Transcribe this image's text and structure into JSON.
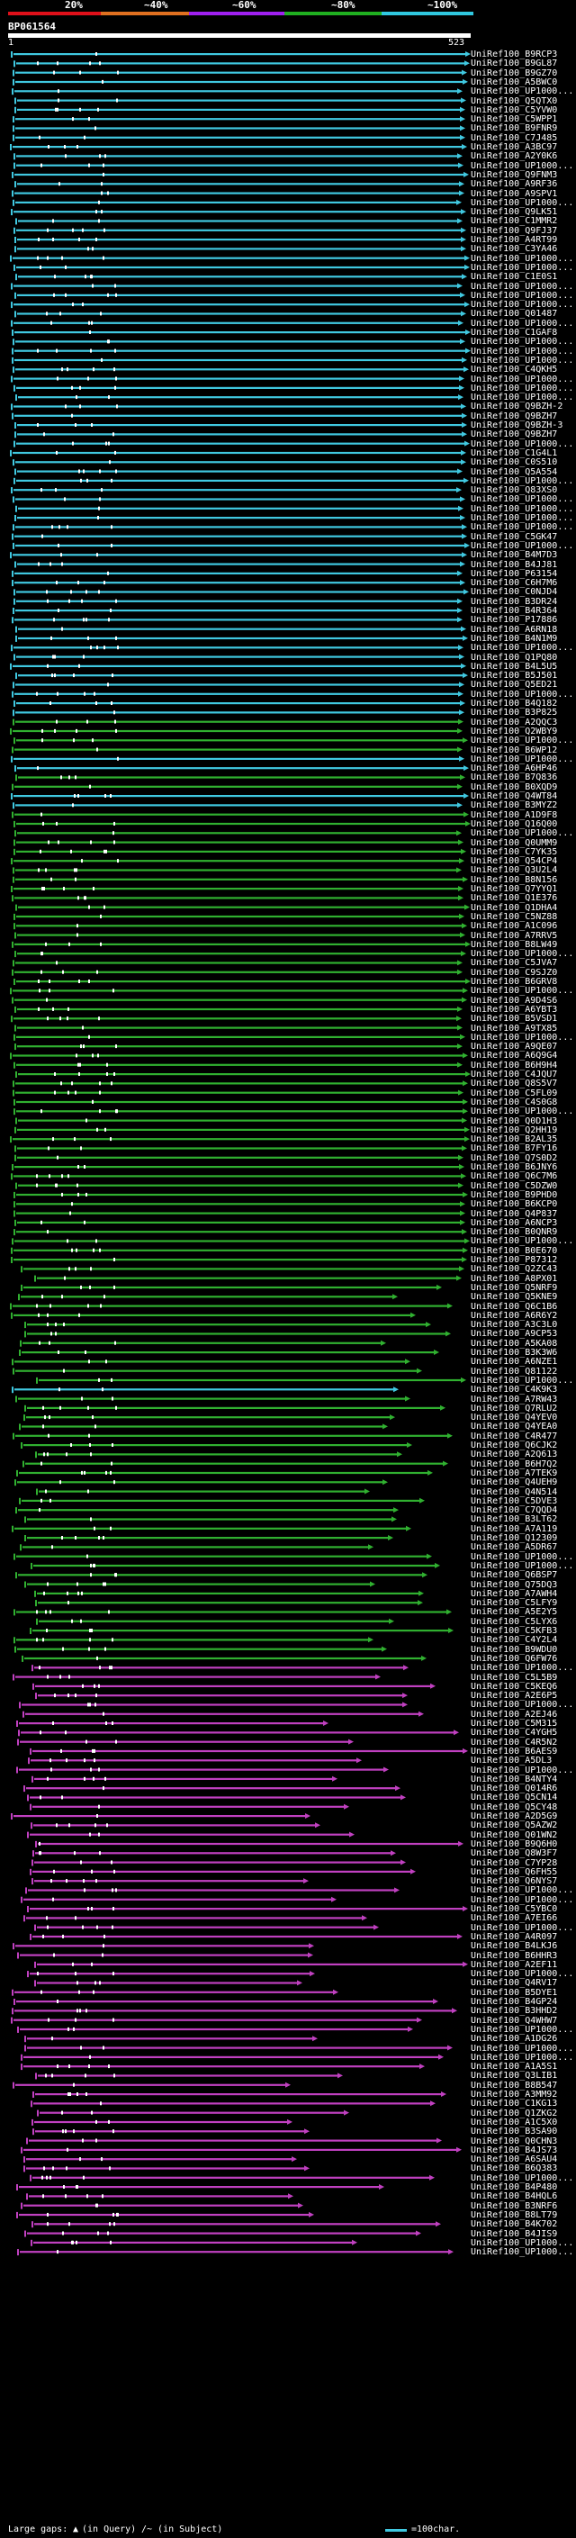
{
  "scale": {
    "ticks": [
      "20%",
      "~40%",
      "~60%",
      "~80%",
      "~100%"
    ],
    "band_colors": [
      "#e0101a",
      "#e07020",
      "#a020f0",
      "#20b020",
      "#30c8e0"
    ]
  },
  "query": {
    "title": "BP061564",
    "start": "1",
    "end": "523"
  },
  "colors": {
    "background": "#000000",
    "cyan": "#40c8e0",
    "green": "#30b030",
    "magenta": "#c040c0",
    "white": "#ffffff"
  },
  "hits": [
    {
      "label": "UniRef100_B9RCP3",
      "c": "cyan"
    },
    {
      "label": "UniRef100_B9GL87",
      "c": "cyan"
    },
    {
      "label": "UniRef100_B9GZ70",
      "c": "cyan"
    },
    {
      "label": "UniRef100_A5BWC0",
      "c": "cyan"
    },
    {
      "label": "UniRef100_UP1000...",
      "c": "cyan"
    },
    {
      "label": "UniRef100_Q5QTX0",
      "c": "cyan"
    },
    {
      "label": "UniRef100_C5YVW0",
      "c": "cyan"
    },
    {
      "label": "UniRef100_C5WPP1",
      "c": "cyan"
    },
    {
      "label": "UniRef100_B9FNR9",
      "c": "cyan"
    },
    {
      "label": "UniRef100_C7J485",
      "c": "cyan"
    },
    {
      "label": "UniRef100_A3BC97",
      "c": "cyan"
    },
    {
      "label": "UniRef100_A2Y0K6",
      "c": "cyan"
    },
    {
      "label": "UniRef100_UP1000...",
      "c": "cyan"
    },
    {
      "label": "UniRef100_Q9FNM3",
      "c": "cyan"
    },
    {
      "label": "UniRef100_A9RF36",
      "c": "cyan"
    },
    {
      "label": "UniRef100_A9SPV1",
      "c": "cyan"
    },
    {
      "label": "UniRef100_UP1000...",
      "c": "cyan"
    },
    {
      "label": "UniRef100_Q9LK51",
      "c": "cyan"
    },
    {
      "label": "UniRef100_C1MMR2",
      "c": "cyan"
    },
    {
      "label": "UniRef100_Q9FJ37",
      "c": "cyan"
    },
    {
      "label": "UniRef100_A4RT99",
      "c": "cyan"
    },
    {
      "label": "UniRef100_C3YA46",
      "c": "cyan"
    },
    {
      "label": "UniRef100_UP1000...",
      "c": "cyan"
    },
    {
      "label": "UniRef100_UP1000...",
      "c": "cyan"
    },
    {
      "label": "UniRef100_C1E0S1",
      "c": "cyan"
    },
    {
      "label": "UniRef100_UP1000...",
      "c": "cyan"
    },
    {
      "label": "UniRef100_UP1000...",
      "c": "cyan"
    },
    {
      "label": "UniRef100_UP1000...",
      "c": "cyan"
    },
    {
      "label": "UniRef100_Q01487",
      "c": "cyan"
    },
    {
      "label": "UniRef100_UP1000...",
      "c": "cyan"
    },
    {
      "label": "UniRef100_C1GAF8",
      "c": "cyan"
    },
    {
      "label": "UniRef100_UP1000...",
      "c": "cyan"
    },
    {
      "label": "UniRef100_UP1000...",
      "c": "cyan"
    },
    {
      "label": "UniRef100_UP1000...",
      "c": "cyan"
    },
    {
      "label": "UniRef100_C4QKH5",
      "c": "cyan"
    },
    {
      "label": "UniRef100_UP1000...",
      "c": "cyan"
    },
    {
      "label": "UniRef100_UP1000...",
      "c": "cyan"
    },
    {
      "label": "UniRef100_UP1000...",
      "c": "cyan"
    },
    {
      "label": "UniRef100_Q9BZH-2",
      "c": "cyan"
    },
    {
      "label": "UniRef100_Q9BZH7",
      "c": "cyan"
    },
    {
      "label": "UniRef100_Q9BZH-3",
      "c": "cyan"
    },
    {
      "label": "UniRef100_Q9BZH7",
      "c": "cyan"
    },
    {
      "label": "UniRef100_UP1000...",
      "c": "cyan"
    },
    {
      "label": "UniRef100_C1G4L1",
      "c": "cyan"
    },
    {
      "label": "UniRef100_C0S510",
      "c": "cyan"
    },
    {
      "label": "UniRef100_Q5A554",
      "c": "cyan"
    },
    {
      "label": "UniRef100_UP1000...",
      "c": "cyan"
    },
    {
      "label": "UniRef100_Q83XS0",
      "c": "cyan"
    },
    {
      "label": "UniRef100_UP1000...",
      "c": "cyan"
    },
    {
      "label": "UniRef100_UP1000...",
      "c": "cyan"
    },
    {
      "label": "UniRef100_UP1000...",
      "c": "cyan"
    },
    {
      "label": "UniRef100_UP1000...",
      "c": "cyan"
    },
    {
      "label": "UniRef100_C5GK47",
      "c": "cyan"
    },
    {
      "label": "UniRef100_UP1000...",
      "c": "cyan"
    },
    {
      "label": "UniRef100_B4M7D3",
      "c": "cyan"
    },
    {
      "label": "UniRef100_B4JJ81",
      "c": "cyan"
    },
    {
      "label": "UniRef100_P63154",
      "c": "cyan"
    },
    {
      "label": "UniRef100_C6H7M6",
      "c": "cyan"
    },
    {
      "label": "UniRef100_C0NJD4",
      "c": "cyan"
    },
    {
      "label": "UniRef100_B3DR24",
      "c": "cyan"
    },
    {
      "label": "UniRef100_B4R364",
      "c": "cyan"
    },
    {
      "label": "UniRef100_P17886",
      "c": "cyan"
    },
    {
      "label": "UniRef100_A6RN18",
      "c": "cyan"
    },
    {
      "label": "UniRef100_B4N1M9",
      "c": "cyan"
    },
    {
      "label": "UniRef100_UP1000...",
      "c": "cyan"
    },
    {
      "label": "UniRef100_Q1PQ80",
      "c": "cyan"
    },
    {
      "label": "UniRef100_B4L5U5",
      "c": "cyan"
    },
    {
      "label": "UniRef100_B5J501",
      "c": "cyan"
    },
    {
      "label": "UniRef100_Q5ED21",
      "c": "cyan"
    },
    {
      "label": "UniRef100_UP1000...",
      "c": "cyan"
    },
    {
      "label": "UniRef100_B4Q182",
      "c": "cyan"
    },
    {
      "label": "UniRef100_B3P825",
      "c": "cyan"
    },
    {
      "label": "UniRef100_A2QQC3",
      "c": "green"
    },
    {
      "label": "UniRef100_Q2WBY9",
      "c": "green"
    },
    {
      "label": "UniRef100_UP1000...",
      "c": "green"
    },
    {
      "label": "UniRef100_B6WP12",
      "c": "green"
    },
    {
      "label": "UniRef100_UP1000...",
      "c": "cyan"
    },
    {
      "label": "UniRef100_A6HP46",
      "c": "cyan"
    },
    {
      "label": "UniRef100_B7Q836",
      "c": "green"
    },
    {
      "label": "UniRef100_B0XQD9",
      "c": "green"
    },
    {
      "label": "UniRef100_Q4WT84",
      "c": "cyan"
    },
    {
      "label": "UniRef100_B3MYZ2",
      "c": "cyan"
    },
    {
      "label": "UniRef100_A1D9F8",
      "c": "green"
    },
    {
      "label": "UniRef100_Q16Q00",
      "c": "green"
    },
    {
      "label": "UniRef100_UP1000...",
      "c": "green"
    },
    {
      "label": "UniRef100_Q0UMM9",
      "c": "green"
    },
    {
      "label": "UniRef100_C7YK35",
      "c": "green"
    },
    {
      "label": "UniRef100_Q54CP4",
      "c": "green"
    },
    {
      "label": "UniRef100_Q3U2L4",
      "c": "green"
    },
    {
      "label": "UniRef100_B8N156",
      "c": "green"
    },
    {
      "label": "UniRef100_Q7YYQ1",
      "c": "green"
    },
    {
      "label": "UniRef100_Q1E376",
      "c": "green"
    },
    {
      "label": "UniRef100_Q1DHA4",
      "c": "green"
    },
    {
      "label": "UniRef100_C5NZ88",
      "c": "green"
    },
    {
      "label": "UniRef100_A1C096",
      "c": "green"
    },
    {
      "label": "UniRef100_A7RRV5",
      "c": "green"
    },
    {
      "label": "UniRef100_B8LW49",
      "c": "green"
    },
    {
      "label": "UniRef100_UP1000...",
      "c": "green"
    },
    {
      "label": "UniRef100_C5JVA7",
      "c": "green"
    },
    {
      "label": "UniRef100_C9SJZ0",
      "c": "green"
    },
    {
      "label": "UniRef100_B6GRV8",
      "c": "green"
    },
    {
      "label": "UniRef100_UP1000...",
      "c": "green"
    },
    {
      "label": "UniRef100_A9D4S6",
      "c": "green"
    },
    {
      "label": "UniRef100_A6YBT3",
      "c": "green"
    },
    {
      "label": "UniRef100_B5VSD1",
      "c": "green"
    },
    {
      "label": "UniRef100_A9TX85",
      "c": "green"
    },
    {
      "label": "UniRef100_UP1000...",
      "c": "green"
    },
    {
      "label": "UniRef100_A9QE07",
      "c": "green"
    },
    {
      "label": "UniRef100_A6Q9G4",
      "c": "green"
    },
    {
      "label": "UniRef100_B6H9H4",
      "c": "green"
    },
    {
      "label": "UniRef100_C4JQU7",
      "c": "green"
    },
    {
      "label": "UniRef100_Q8S5V7",
      "c": "green"
    },
    {
      "label": "UniRef100_C5FL09",
      "c": "green"
    },
    {
      "label": "UniRef100_C4S0G8",
      "c": "green"
    },
    {
      "label": "UniRef100_UP1000...",
      "c": "green"
    },
    {
      "label": "UniRef100_Q0D1H3",
      "c": "green"
    },
    {
      "label": "UniRef100_Q2HH19",
      "c": "green"
    },
    {
      "label": "UniRef100_B2AL35",
      "c": "green"
    },
    {
      "label": "UniRef100_B7FY16",
      "c": "green"
    },
    {
      "label": "UniRef100_Q7S0D2",
      "c": "green"
    },
    {
      "label": "UniRef100_B6JNY6",
      "c": "green"
    },
    {
      "label": "UniRef100_Q6C7M6",
      "c": "green"
    },
    {
      "label": "UniRef100_C5DZW0",
      "c": "green"
    },
    {
      "label": "UniRef100_B9PHD0",
      "c": "green"
    },
    {
      "label": "UniRef100_B6KCP0",
      "c": "green"
    },
    {
      "label": "UniRef100_Q4P837",
      "c": "green"
    },
    {
      "label": "UniRef100_A6NCP3",
      "c": "green"
    },
    {
      "label": "UniRef100_B0QNR9",
      "c": "green"
    },
    {
      "label": "UniRef100_UP1000...",
      "c": "green"
    },
    {
      "label": "UniRef100_B0E670",
      "c": "green"
    },
    {
      "label": "UniRef100_P87312",
      "c": "green"
    },
    {
      "label": "UniRef100_Q2ZC43",
      "c": "green"
    },
    {
      "label": "UniRef100_A8PX01",
      "c": "green"
    },
    {
      "label": "UniRef100_Q5NRF9",
      "c": "green"
    },
    {
      "label": "UniRef100_Q5KNE9",
      "c": "green"
    },
    {
      "label": "UniRef100_Q6C1B6",
      "c": "green"
    },
    {
      "label": "UniRef100_A6R6Y2",
      "c": "green"
    },
    {
      "label": "UniRef100_A3C3L0",
      "c": "green"
    },
    {
      "label": "UniRef100_A9CP53",
      "c": "green"
    },
    {
      "label": "UniRef100_A5KA08",
      "c": "green"
    },
    {
      "label": "UniRef100_B3K3W6",
      "c": "green"
    },
    {
      "label": "UniRef100_A6NZE1",
      "c": "green"
    },
    {
      "label": "UniRef100_Q81122",
      "c": "green"
    },
    {
      "label": "UniRef100_UP1000...",
      "c": "green"
    },
    {
      "label": "UniRef100_C4K9K3",
      "c": "cyan"
    },
    {
      "label": "UniRef100_A7RW43",
      "c": "green"
    },
    {
      "label": "UniRef100_Q7RLU2",
      "c": "green"
    },
    {
      "label": "UniRef100_Q4YEV0",
      "c": "green"
    },
    {
      "label": "UniRef100_Q4YEA0",
      "c": "green"
    },
    {
      "label": "UniRef100_C4R477",
      "c": "green"
    },
    {
      "label": "UniRef100_Q6CJK2",
      "c": "green"
    },
    {
      "label": "UniRef100_A2Q613",
      "c": "green"
    },
    {
      "label": "UniRef100_B6H7Q2",
      "c": "green"
    },
    {
      "label": "UniRef100_A7TEK9",
      "c": "green"
    },
    {
      "label": "UniRef100_Q4UEH9",
      "c": "green"
    },
    {
      "label": "UniRef100_Q4N514",
      "c": "green"
    },
    {
      "label": "UniRef100_C5DVE3",
      "c": "green"
    },
    {
      "label": "UniRef100_C7QQD4",
      "c": "green"
    },
    {
      "label": "UniRef100_B3LT62",
      "c": "green"
    },
    {
      "label": "UniRef100_A7A119",
      "c": "green"
    },
    {
      "label": "UniRef100_Q12309",
      "c": "green"
    },
    {
      "label": "UniRef100_A5DR67",
      "c": "green"
    },
    {
      "label": "UniRef100_UP1000...",
      "c": "green"
    },
    {
      "label": "UniRef100_UP1000...",
      "c": "green"
    },
    {
      "label": "UniRef100_Q6BSP7",
      "c": "green"
    },
    {
      "label": "UniRef100_Q75DQ3",
      "c": "green"
    },
    {
      "label": "UniRef100_A7AWH4",
      "c": "green"
    },
    {
      "label": "UniRef100_C5LFY9",
      "c": "green"
    },
    {
      "label": "UniRef100_A5E2Y5",
      "c": "green"
    },
    {
      "label": "UniRef100_C5LYX6",
      "c": "green"
    },
    {
      "label": "UniRef100_C5KFB3",
      "c": "green"
    },
    {
      "label": "UniRef100_C4Y2L4",
      "c": "green"
    },
    {
      "label": "UniRef100_B9WDU0",
      "c": "green"
    },
    {
      "label": "UniRef100_Q6FW76",
      "c": "green"
    },
    {
      "label": "UniRef100_UP1000...",
      "c": "magenta"
    },
    {
      "label": "UniRef100_C5L5B9",
      "c": "magenta"
    },
    {
      "label": "UniRef100_C5KEQ6",
      "c": "magenta"
    },
    {
      "label": "UniRef100_A2E6P5",
      "c": "magenta"
    },
    {
      "label": "UniRef100_UP1000...",
      "c": "magenta"
    },
    {
      "label": "UniRef100_A2EJ46",
      "c": "magenta"
    },
    {
      "label": "UniRef100_C5M315",
      "c": "magenta"
    },
    {
      "label": "UniRef100_C4YGH5",
      "c": "magenta"
    },
    {
      "label": "UniRef100_C4R5N2",
      "c": "magenta"
    },
    {
      "label": "UniRef100_B6AES9",
      "c": "magenta"
    },
    {
      "label": "UniRef100_A5DL3",
      "c": "magenta"
    },
    {
      "label": "UniRef100_UP1000...",
      "c": "magenta"
    },
    {
      "label": "UniRef100_B4NTY4",
      "c": "magenta"
    },
    {
      "label": "UniRef100_Q014R6",
      "c": "magenta"
    },
    {
      "label": "UniRef100_Q5CN14",
      "c": "magenta"
    },
    {
      "label": "UniRef100_Q5CY48",
      "c": "magenta"
    },
    {
      "label": "UniRef100_A2D5G9",
      "c": "magenta"
    },
    {
      "label": "UniRef100_Q5AZW2",
      "c": "magenta"
    },
    {
      "label": "UniRef100_Q01WN2",
      "c": "magenta"
    },
    {
      "label": "UniRef100_B9Q6H0",
      "c": "magenta"
    },
    {
      "label": "UniRef100_Q8W3F7",
      "c": "magenta"
    },
    {
      "label": "UniRef100_C7YP28",
      "c": "magenta"
    },
    {
      "label": "UniRef100_Q6FH55",
      "c": "magenta"
    },
    {
      "label": "UniRef100_Q6NYS7",
      "c": "magenta"
    },
    {
      "label": "UniRef100_UP1000...",
      "c": "magenta"
    },
    {
      "label": "UniRef100_UP1000...",
      "c": "magenta"
    },
    {
      "label": "UniRef100_C5YBC0",
      "c": "magenta"
    },
    {
      "label": "UniRef100_A7EI66",
      "c": "magenta"
    },
    {
      "label": "UniRef100_UP1000...",
      "c": "magenta"
    },
    {
      "label": "UniRef100_A4R097",
      "c": "magenta"
    },
    {
      "label": "UniRef100_B4LKJ6",
      "c": "magenta"
    },
    {
      "label": "UniRef100_B6HHR3",
      "c": "magenta"
    },
    {
      "label": "UniRef100_A2EF11",
      "c": "magenta"
    },
    {
      "label": "UniRef100_UP1000...",
      "c": "magenta"
    },
    {
      "label": "UniRef100_Q4RV17",
      "c": "magenta"
    },
    {
      "label": "UniRef100_B5DYE1",
      "c": "magenta"
    },
    {
      "label": "UniRef100_B4GP24",
      "c": "magenta"
    },
    {
      "label": "UniRef100_B3HHD2",
      "c": "magenta"
    },
    {
      "label": "UniRef100_Q4WHW7",
      "c": "magenta"
    },
    {
      "label": "UniRef100_UP1000...",
      "c": "magenta"
    },
    {
      "label": "UniRef100_A1DG26",
      "c": "magenta"
    },
    {
      "label": "UniRef100_UP1000...",
      "c": "magenta"
    },
    {
      "label": "UniRef100_UP1000...",
      "c": "magenta"
    },
    {
      "label": "UniRef100_A1A5S1",
      "c": "magenta"
    },
    {
      "label": "UniRef100_Q3LIB1",
      "c": "magenta"
    },
    {
      "label": "UniRef100_B8B547",
      "c": "magenta"
    },
    {
      "label": "UniRef100_A3MM92",
      "c": "magenta"
    },
    {
      "label": "UniRef100_C1KG13",
      "c": "magenta"
    },
    {
      "label": "UniRef100_Q1ZKG2",
      "c": "magenta"
    },
    {
      "label": "UniRef100_A1C5X0",
      "c": "magenta"
    },
    {
      "label": "UniRef100_B3SA90",
      "c": "magenta"
    },
    {
      "label": "UniRef100_Q0CHN3",
      "c": "magenta"
    },
    {
      "label": "UniRef100_B4JS73",
      "c": "magenta"
    },
    {
      "label": "UniRef100_A6SAU4",
      "c": "magenta"
    },
    {
      "label": "UniRef100_B6Q383",
      "c": "magenta"
    },
    {
      "label": "UniRef100_UP1000...",
      "c": "magenta"
    },
    {
      "label": "UniRef100_B4P480",
      "c": "magenta"
    },
    {
      "label": "UniRef100_B4HQL6",
      "c": "magenta"
    },
    {
      "label": "UniRef100_B3NRF6",
      "c": "magenta"
    },
    {
      "label": "UniRef100_B8LT79",
      "c": "magenta"
    },
    {
      "label": "UniRef100_B4K702",
      "c": "magenta"
    },
    {
      "label": "UniRef100_B4JIS9",
      "c": "magenta"
    },
    {
      "label": "UniRef100_UP1000...",
      "c": "magenta"
    },
    {
      "label": "UniRef100_UP1000...",
      "c": "magenta"
    }
  ],
  "footer": {
    "large_gaps": "Large gaps:",
    "in_query": "(in Query)",
    "in_subject": "/~ (in Subject)",
    "legend": "=100char."
  }
}
